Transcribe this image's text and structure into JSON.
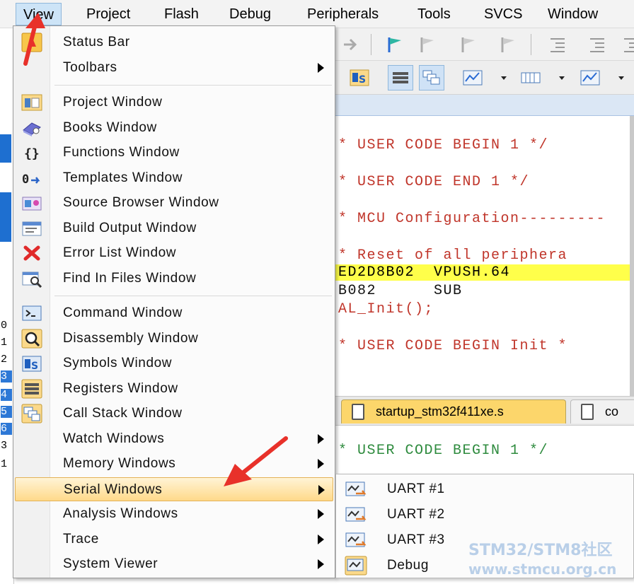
{
  "menubar": {
    "items": [
      "View",
      "Project",
      "Flash",
      "Debug",
      "Peripherals",
      "Tools",
      "SVCS",
      "Window"
    ]
  },
  "view_menu": {
    "groups": [
      [
        {
          "label": "Status Bar",
          "icon": "status-bar-icon",
          "submenu": false
        },
        {
          "label": "Toolbars",
          "icon": "",
          "submenu": true
        }
      ],
      [
        {
          "label": "Project Window",
          "icon": "project-window-icon",
          "submenu": false
        },
        {
          "label": "Books Window",
          "icon": "books-icon",
          "submenu": false
        },
        {
          "label": "Functions Window",
          "icon": "braces-icon",
          "submenu": false
        },
        {
          "label": "Templates Window",
          "icon": "templates-icon",
          "submenu": false
        },
        {
          "label": "Source Browser Window",
          "icon": "source-browser-icon",
          "submenu": false
        },
        {
          "label": "Build Output Window",
          "icon": "build-output-icon",
          "submenu": false
        },
        {
          "label": "Error List Window",
          "icon": "error-x-icon",
          "submenu": false
        },
        {
          "label": "Find In Files Window",
          "icon": "find-in-files-icon",
          "submenu": false
        }
      ],
      [
        {
          "label": "Command Window",
          "icon": "command-prompt-icon",
          "submenu": false
        },
        {
          "label": "Disassembly Window",
          "icon": "disassembly-icon",
          "submenu": false
        },
        {
          "label": "Symbols Window",
          "icon": "symbols-icon",
          "submenu": false
        },
        {
          "label": "Registers Window",
          "icon": "registers-icon",
          "submenu": false
        },
        {
          "label": "Call Stack Window",
          "icon": "call-stack-icon",
          "submenu": false
        },
        {
          "label": "Watch Windows",
          "icon": "",
          "submenu": true
        },
        {
          "label": "Memory Windows",
          "icon": "",
          "submenu": true
        },
        {
          "label": "Serial Windows",
          "icon": "",
          "submenu": true,
          "highlighted": true
        },
        {
          "label": "Analysis Windows",
          "icon": "",
          "submenu": true
        },
        {
          "label": "Trace",
          "icon": "",
          "submenu": true
        },
        {
          "label": "System Viewer",
          "icon": "",
          "submenu": true
        }
      ]
    ]
  },
  "serial_submenu": {
    "items": [
      {
        "label": "UART #1",
        "icon": "uart-icon"
      },
      {
        "label": "UART #2",
        "icon": "uart-icon"
      },
      {
        "label": "UART #3",
        "icon": "uart-icon"
      },
      {
        "label": "Debug",
        "icon": "debug-viewer-icon"
      }
    ]
  },
  "editor": {
    "lines": [
      {
        "text": "* USER CODE BEGIN 1 */",
        "style": "red"
      },
      {
        "text": "* USER CODE END 1 */",
        "style": "red"
      },
      {
        "text": "* MCU Configuration---------",
        "style": "red"
      },
      {
        "text": "* Reset of all periphera",
        "style": "red"
      },
      {
        "text": "ED2D8B02  VPUSH.64",
        "style": "hl"
      },
      {
        "text": "B082      SUB",
        "style": "blk"
      },
      {
        "text": "AL_Init();",
        "style": "red"
      },
      {
        "text": "* USER CODE BEGIN Init *",
        "style": "red"
      }
    ],
    "tabs": [
      {
        "label": "startup_stm32f411xe.s",
        "active": true
      },
      {
        "label": "co",
        "active": false
      }
    ],
    "lower_lines": [
      {
        "text": "* USER CODE BEGIN 1 */",
        "style": "green"
      }
    ]
  },
  "left_strip": {
    "numbers": [
      "0",
      "1",
      "2",
      "3",
      "4",
      "5",
      "6",
      "3",
      "1"
    ]
  },
  "watermark": {
    "line1": "STM32/STM8社区",
    "line2": "www.stmcu.org.cn"
  },
  "colors": {
    "menu_highlight": "#ffd98a",
    "code_red": "#c0352a",
    "code_green": "#2e8b3e",
    "exec_highlight": "#ffff4a",
    "annotation_arrow": "#e8312a",
    "active_tab": "#fcd66b"
  }
}
